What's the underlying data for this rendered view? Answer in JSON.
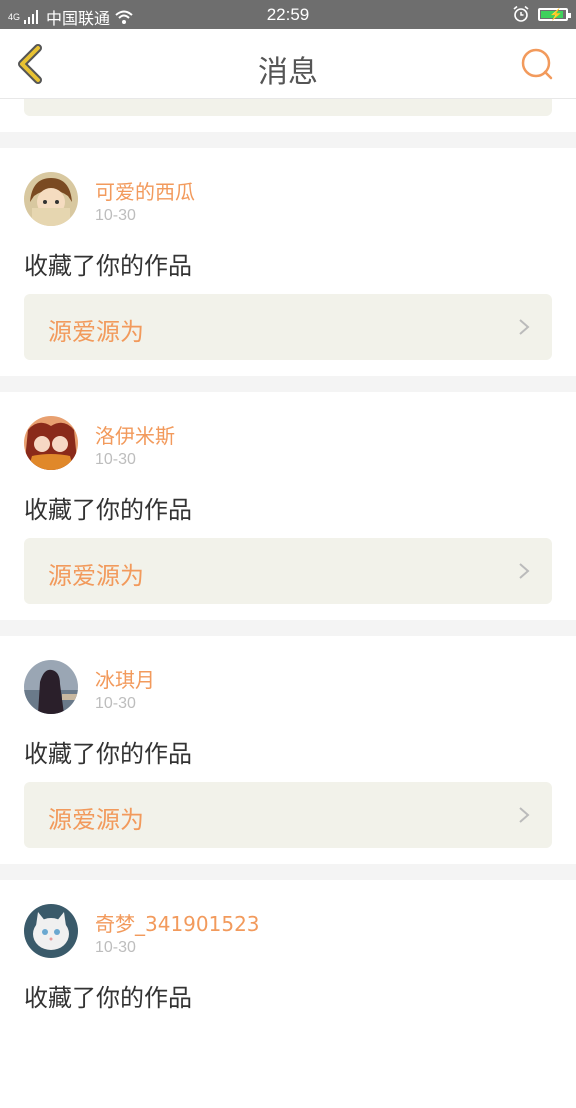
{
  "status_bar": {
    "network": "4G",
    "carrier": "中国联通",
    "time": "22:59",
    "battery_level": 0.85,
    "icons": [
      "signal-icon",
      "wifi-icon",
      "alarm-icon",
      "battery-charging-icon"
    ]
  },
  "header": {
    "title": "消息",
    "back_icon": "back-chevron-icon",
    "search_icon": "search-icon",
    "accent": "#f29a5c",
    "back_color": "#e8c232"
  },
  "messages": [
    {
      "user": "可爱的西瓜",
      "date": "10-30",
      "action": "收藏了你的作品",
      "work": "源爱源为"
    },
    {
      "user": "洛伊米斯",
      "date": "10-30",
      "action": "收藏了你的作品",
      "work": "源爱源为"
    },
    {
      "user": "冰琪月",
      "date": "10-30",
      "action": "收藏了你的作品",
      "work": "源爱源为"
    },
    {
      "user": "奇梦_341901523",
      "date": "10-30",
      "action": "收藏了你的作品"
    }
  ]
}
